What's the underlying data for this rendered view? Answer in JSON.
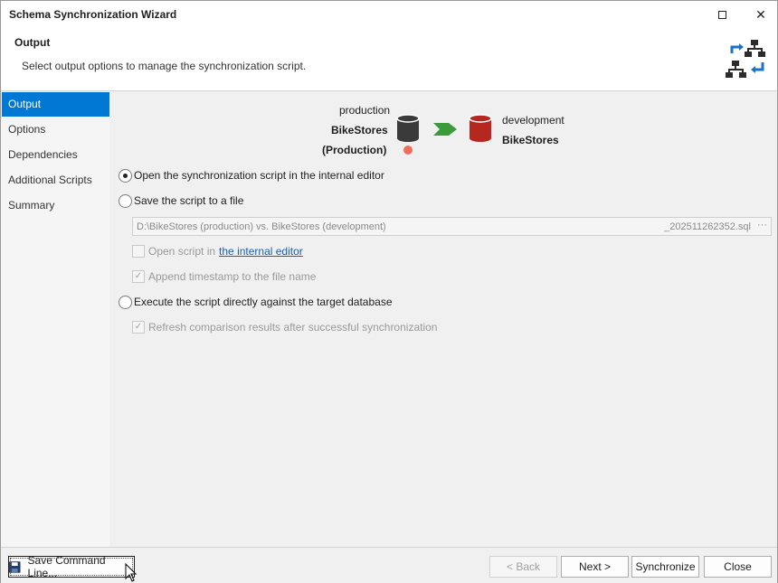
{
  "window": {
    "title": "Schema Synchronization Wizard"
  },
  "header": {
    "title": "Output",
    "description": "Select output options to manage the synchronization script."
  },
  "sidebar": {
    "items": [
      {
        "label": "Output",
        "active": true
      },
      {
        "label": "Options",
        "active": false
      },
      {
        "label": "Dependencies",
        "active": false
      },
      {
        "label": "Additional Scripts",
        "active": false
      },
      {
        "label": "Summary",
        "active": false
      }
    ]
  },
  "source_db": {
    "connection": "production",
    "name": "BikeStores",
    "environment": "(Production)",
    "status_color": "#f26b5b"
  },
  "target_db": {
    "connection": "development",
    "name": "BikeStores"
  },
  "colors": {
    "accent": "#0078d4",
    "source_db": "#3a3a3a",
    "target_db": "#b5271f",
    "arrow": "#3b9b3b",
    "link": "#1a5fb4"
  },
  "options": {
    "open_internal": "Open the synchronization script in the internal editor",
    "save_file": "Save the script to a file",
    "file_path_left": "D:\\BikeStores (production) vs. BikeStores (development)",
    "file_path_right": "_202511262352.sql",
    "browse": "···",
    "open_script_prefix": "Open script in",
    "open_script_link": "the internal editor",
    "append_timestamp": "Append timestamp to the file name",
    "execute_direct": "Execute the script directly against the target database",
    "refresh_results": "Refresh comparison results after successful synchronization"
  },
  "footer": {
    "save_command_line": "Save Command Line...",
    "back": "< Back",
    "next": "Next >",
    "synchronize": "Synchronize",
    "close": "Close"
  }
}
